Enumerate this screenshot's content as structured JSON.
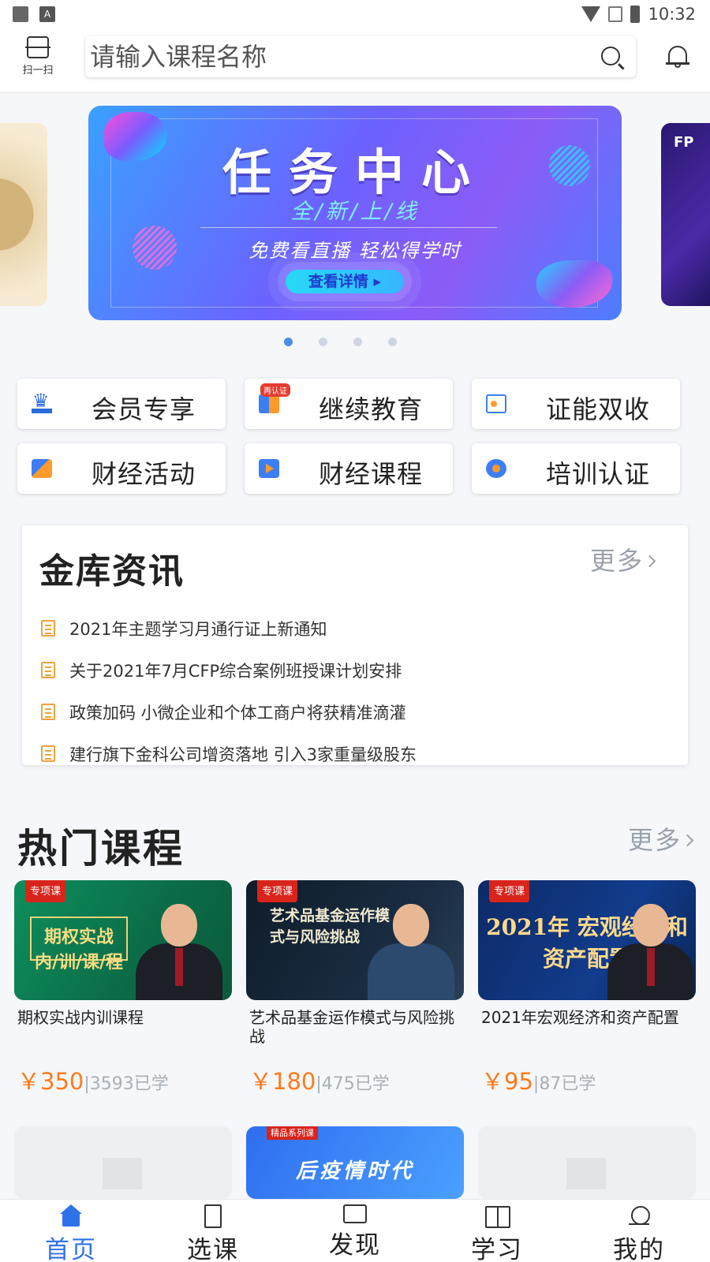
{
  "status_bar": {
    "time": "10:32",
    "app_icon_letter": "A"
  },
  "header": {
    "scan_label": "扫一扫",
    "search_placeholder": "请输入课程名称"
  },
  "banner": {
    "title": "任务中心",
    "subtitle": "全/新/上/线",
    "tagline": "免费看直播 轻松得学时",
    "button_label": "查看详情 ▸",
    "right_card_text": "FP",
    "active_slide": 1,
    "slide_count": 4
  },
  "quick_links": [
    {
      "label": "会员专享",
      "icon": "crown-icon"
    },
    {
      "label": "继续教育",
      "icon": "book-icon",
      "badge": "再认证"
    },
    {
      "label": "证能双收",
      "icon": "certificate-icon"
    },
    {
      "label": "财经活动",
      "icon": "activity-icon"
    },
    {
      "label": "财经课程",
      "icon": "video-course-icon"
    },
    {
      "label": "培训认证",
      "icon": "badge-icon"
    }
  ],
  "news": {
    "title": "金库资讯",
    "more_label": "更多",
    "items": [
      "2021年主题学习月通行证上新通知",
      "关于2021年7月CFP综合案例班授课计划安排",
      "政策加码 小微企业和个体工商户将获精准滴灌",
      "建行旗下金科公司增资落地 引入3家重量级股东"
    ]
  },
  "hot_courses": {
    "title": "热门课程",
    "more_label": "更多",
    "items": [
      {
        "tag": "专项课",
        "thumb_text": "期权实战 内/训/课/程",
        "name": "期权实战内训课程",
        "price": "￥350",
        "learned": "|3593已学"
      },
      {
        "tag": "专项课",
        "thumb_text": "艺术品基金运作模式与风险挑战",
        "name": "艺术品基金运作模式与风险挑战",
        "price": "￥180",
        "learned": "|475已学"
      },
      {
        "tag": "专项课",
        "thumb_text": "2021年 宏观经济和资产配置",
        "name": "2021年宏观经济和资产配置",
        "price": "￥95",
        "learned": "|87已学"
      }
    ],
    "row2_promo_tag": "精品系列课",
    "row2_promo_text": "后疫情时代"
  },
  "bottom_nav": [
    {
      "label": "首页",
      "icon": "home-icon",
      "active": true
    },
    {
      "label": "选课",
      "icon": "book-icon"
    },
    {
      "label": "发现",
      "icon": "chat-icon"
    },
    {
      "label": "学习",
      "icon": "open-book-icon"
    },
    {
      "label": "我的",
      "icon": "user-icon"
    }
  ],
  "colors": {
    "accent": "#2f72e8",
    "price": "#ff7a1a",
    "tag_red": "#d9241c"
  }
}
